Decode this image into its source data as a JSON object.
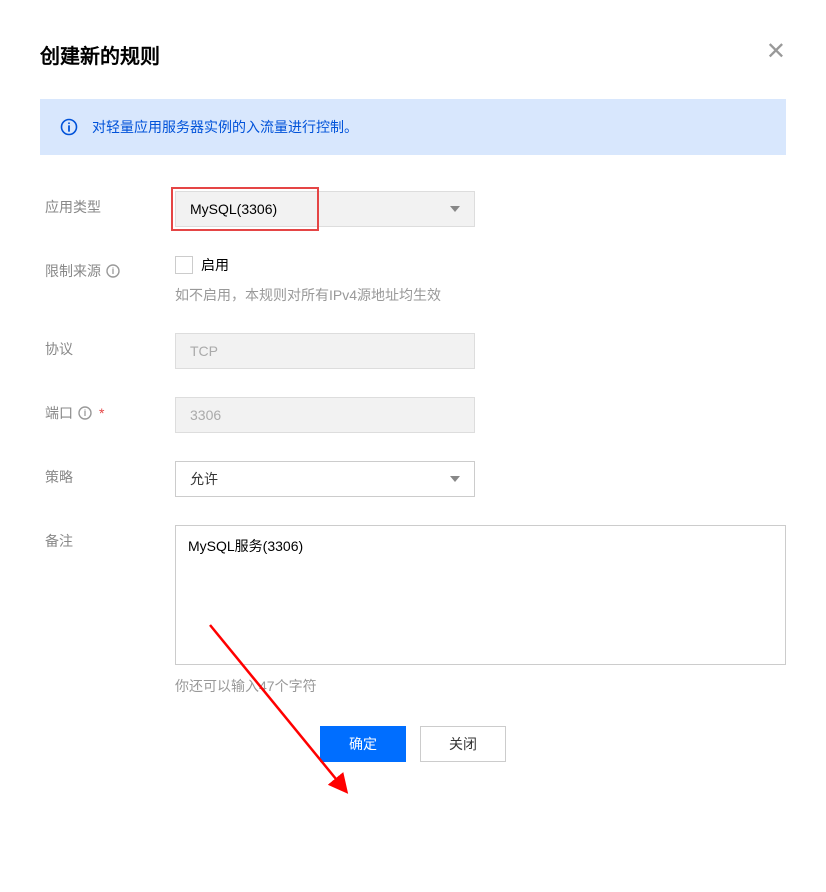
{
  "dialog": {
    "title": "创建新的规则",
    "close_glyph": "✕"
  },
  "banner": {
    "text": "对轻量应用服务器实例的入流量进行控制。"
  },
  "fields": {
    "app_type": {
      "label": "应用类型",
      "value": "MySQL(3306)"
    },
    "restrict_source": {
      "label": "限制来源",
      "checkbox_label": "启用",
      "hint": "如不启用，本规则对所有IPv4源地址均生效"
    },
    "protocol": {
      "label": "协议",
      "value": "TCP"
    },
    "port": {
      "label": "端口",
      "value": "3306"
    },
    "policy": {
      "label": "策略",
      "value": "允许"
    },
    "remark": {
      "label": "备注",
      "value": "MySQL服务(3306)",
      "char_hint": "你还可以输入47个字符"
    }
  },
  "buttons": {
    "confirm": "确定",
    "close": "关闭"
  }
}
